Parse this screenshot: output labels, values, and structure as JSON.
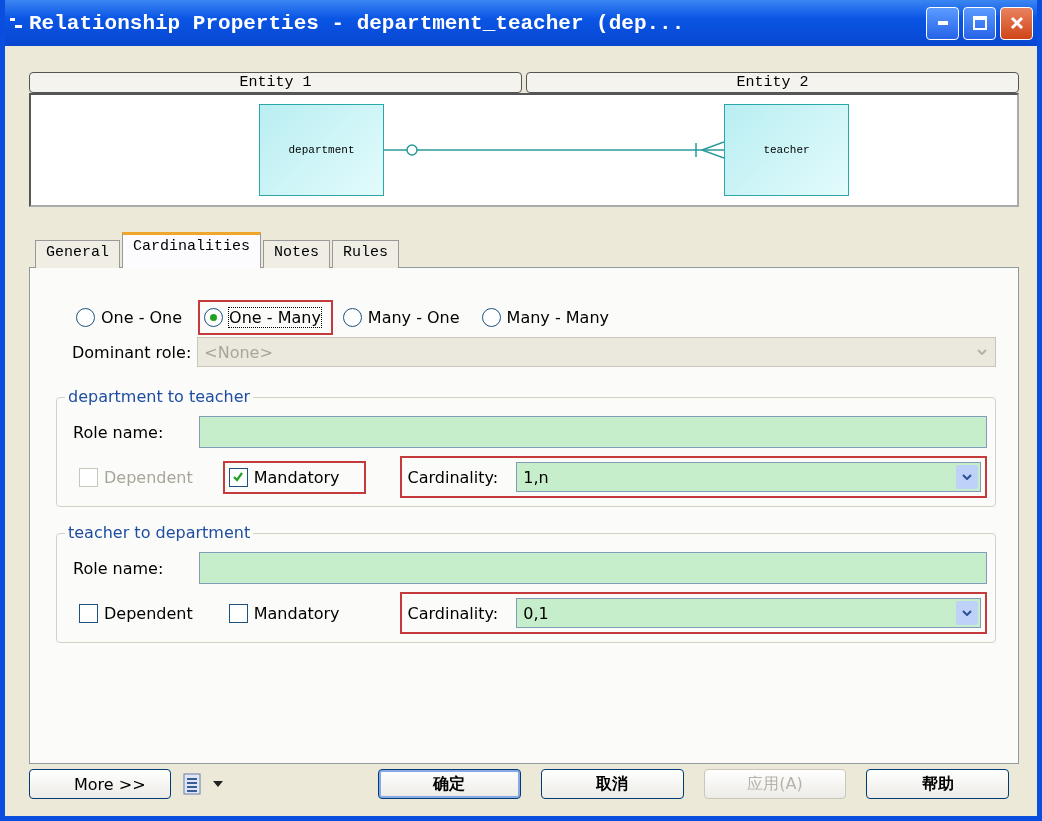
{
  "window": {
    "title": "Relationship Properties - department_teacher (dep..."
  },
  "entity_headers": [
    "Entity 1",
    "Entity 2"
  ],
  "diagram": {
    "entity_1": "department",
    "entity_2": "teacher"
  },
  "tabs": [
    {
      "label": "General",
      "selected": false
    },
    {
      "label": "Cardinalities",
      "selected": true
    },
    {
      "label": "Notes",
      "selected": false
    },
    {
      "label": "Rules",
      "selected": false
    }
  ],
  "cardinality_options": [
    {
      "label": "One - One",
      "selected": false,
      "highlighted": false
    },
    {
      "label": "One - Many",
      "selected": true,
      "highlighted": true
    },
    {
      "label": "Many - One",
      "selected": false,
      "highlighted": false
    },
    {
      "label": "Many - Many",
      "selected": false,
      "highlighted": false
    }
  ],
  "dominant_role": {
    "label": "Dominant role:",
    "value": "<None>",
    "disabled": true
  },
  "roles": [
    {
      "title": "department to teacher",
      "role_name_label": "Role name:",
      "dependent": {
        "label": "Dependent",
        "checked": false,
        "disabled": true,
        "highlighted": false
      },
      "mandatory": {
        "label": "Mandatory",
        "checked": true,
        "disabled": false,
        "highlighted": true
      },
      "cardinality": {
        "label": "Cardinality:",
        "value": "1,n",
        "highlighted": true
      }
    },
    {
      "title": "teacher to department",
      "role_name_label": "Role name:",
      "dependent": {
        "label": "Dependent",
        "checked": false,
        "disabled": false,
        "highlighted": false
      },
      "mandatory": {
        "label": "Mandatory",
        "checked": false,
        "disabled": false,
        "highlighted": false
      },
      "cardinality": {
        "label": "Cardinality:",
        "value": "0,1",
        "highlighted": true
      }
    }
  ],
  "footer": {
    "more": "More >>",
    "buttons": [
      {
        "label": "确定",
        "disabled": false,
        "default": true
      },
      {
        "label": "取消",
        "disabled": false,
        "default": false
      },
      {
        "label": "应用(A)",
        "disabled": true,
        "default": false
      },
      {
        "label": "帮助",
        "disabled": false,
        "default": false
      }
    ]
  }
}
